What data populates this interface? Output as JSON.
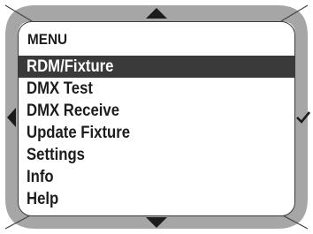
{
  "menu": {
    "title": "MENU",
    "items": [
      {
        "label": "RDM/Fixture",
        "selected": true
      },
      {
        "label": "DMX Test",
        "selected": false
      },
      {
        "label": "DMX Receive",
        "selected": false
      },
      {
        "label": "Update Fixture",
        "selected": false
      },
      {
        "label": "Settings",
        "selected": false
      },
      {
        "label": "Info",
        "selected": false
      },
      {
        "label": "Help",
        "selected": false
      }
    ]
  },
  "controls": {
    "up": "triangle-up-icon",
    "down": "triangle-down-icon",
    "back": "triangle-left-icon",
    "confirm": "checkmark-icon"
  },
  "colors": {
    "bezel": "#a6a6a6",
    "selection": "#3a3a3a",
    "text": "#1c1c1c"
  }
}
